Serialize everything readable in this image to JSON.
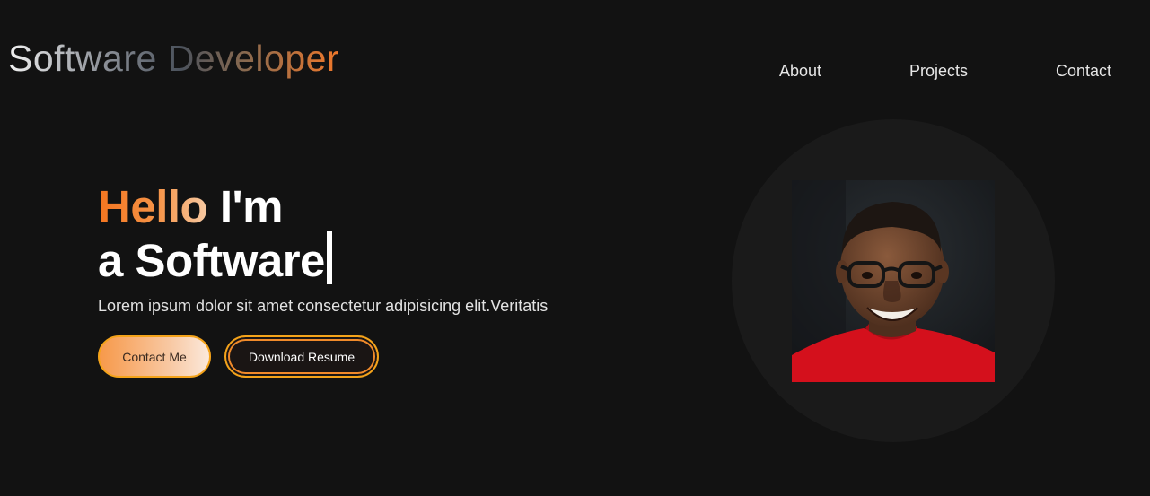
{
  "header": {
    "logo": "Software Developer",
    "nav": [
      "About",
      "Projects",
      "Contact"
    ]
  },
  "hero": {
    "greeting": "Hello",
    "im": "I'm",
    "line2": "a Software",
    "description": "Lorem ipsum dolor sit amet consectetur adipisicing elit.Veritatis",
    "buttons": {
      "contact": "Contact Me",
      "resume": "Download Resume"
    }
  },
  "colors": {
    "background": "#121212",
    "accent": "#f5751f",
    "button_border": "#f4a31a"
  }
}
